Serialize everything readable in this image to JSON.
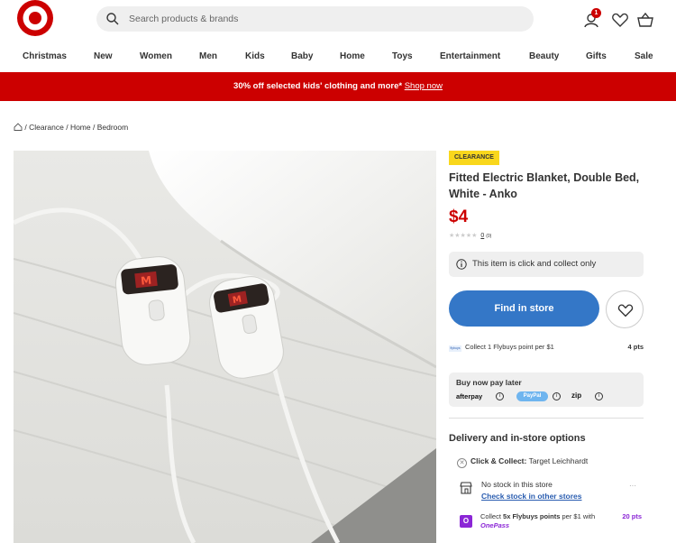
{
  "header": {
    "search_placeholder": "Search products & brands",
    "cart_badge": "1"
  },
  "nav": {
    "items": [
      "Christmas",
      "New",
      "Women",
      "Men",
      "Kids",
      "Baby",
      "Home",
      "Toys",
      "Entertainment",
      "Beauty",
      "Gifts",
      "Sale"
    ]
  },
  "promo": {
    "text": "30% off selected kids' clothing and more*",
    "link": "Shop now"
  },
  "breadcrumb": {
    "sep": " / ",
    "items": [
      "Clearance",
      "Home",
      "Bedroom"
    ]
  },
  "product": {
    "tag": "CLEARANCE",
    "title": "Fitted Electric Blanket, Double Bed, White - Anko",
    "price": "$4",
    "stars": "★★★★★",
    "review_count": "0",
    "review_count_small": "(0)",
    "availability_note": "This item is click and collect only",
    "find_button": "Find in store",
    "flybuys": {
      "text": "Collect 1 Flybuys point per $1",
      "points": "4 pts",
      "logo": "flybuys"
    },
    "bnpl": {
      "heading": "Buy now pay later",
      "afterpay": "afterpay",
      "paypal": "PayPal",
      "zip": "zip"
    },
    "delivery": {
      "heading": "Delivery and in-store options",
      "click_collect_label": "Click & Collect:",
      "click_collect_store": "Target Leichhardt",
      "no_stock": "No stock in this store",
      "check_stock_link": "Check stock in other stores",
      "more": "···",
      "onepass_prefix": "Collect",
      "onepass_bold": "5x Flybuys points",
      "onepass_suffix": "per $1 with",
      "onepass_brand": "OnePass",
      "onepass_points": "20 pts"
    }
  },
  "colors": {
    "brand_red": "#cc0000",
    "find_button_blue": "#3477c7",
    "clearance_yellow": "#f9d71c",
    "onepass_purple": "#8b26d6"
  },
  "icons": [
    "target-logo-icon",
    "search-icon",
    "account-icon",
    "heart-icon",
    "basket-icon",
    "home-icon",
    "info-icon",
    "store-icon"
  ]
}
